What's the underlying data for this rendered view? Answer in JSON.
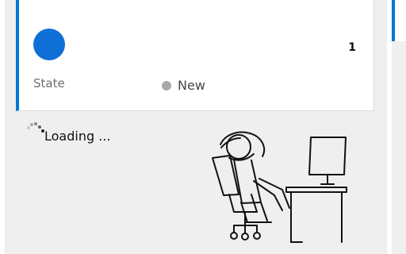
{
  "card": {
    "count": "1",
    "state_label": "State",
    "state_value": "New",
    "avatar_color": "#0e6fd6",
    "accent_color": "#0078d4",
    "state_dot_color": "#a8a8a8"
  },
  "loading": {
    "text": "Loading ..."
  },
  "illustration": {
    "icon": "person-relaxing-at-desk-icon"
  }
}
